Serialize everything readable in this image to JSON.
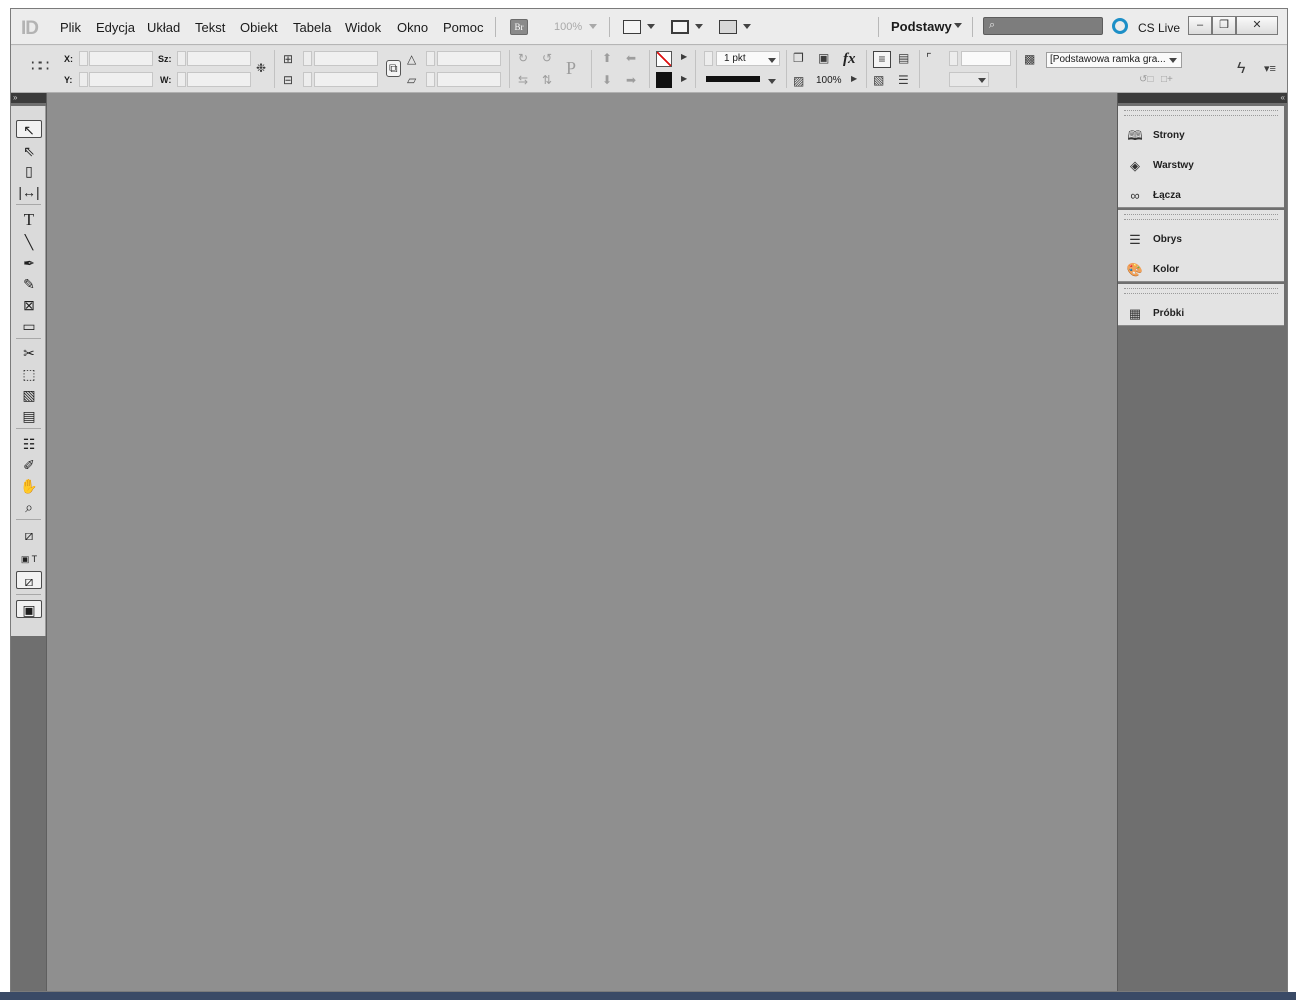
{
  "app": {
    "logo": "ID"
  },
  "menu": [
    "Plik",
    "Edycja",
    "Układ",
    "Tekst",
    "Obiekt",
    "Tabela",
    "Widok",
    "Okno",
    "Pomoc"
  ],
  "appbar": {
    "bridge_label": "Br",
    "zoom": "100%",
    "workspace": "Podstawy",
    "search_placeholder": "",
    "cslive": "CS Live"
  },
  "control": {
    "x_label": "X:",
    "y_label": "Y:",
    "w_label": "Sz:",
    "h_label": "W:",
    "stroke_weight": "1 pkt",
    "opacity": "100%",
    "frame_style": "[Podstawowa ramka gra..."
  },
  "panels": {
    "group1": [
      {
        "label": "Strony",
        "icon": "pages-icon"
      },
      {
        "label": "Warstwy",
        "icon": "layers-icon"
      },
      {
        "label": "Łącza",
        "icon": "links-icon"
      }
    ],
    "group2": [
      {
        "label": "Obrys",
        "icon": "stroke-icon"
      },
      {
        "label": "Kolor",
        "icon": "color-icon"
      }
    ],
    "group3": [
      {
        "label": "Próbki",
        "icon": "swatches-icon"
      }
    ]
  },
  "colors": {
    "canvas": "#8f8f8f",
    "panel_dark": "#6f6f6f",
    "cslive_accent": "#1d8fc7"
  }
}
